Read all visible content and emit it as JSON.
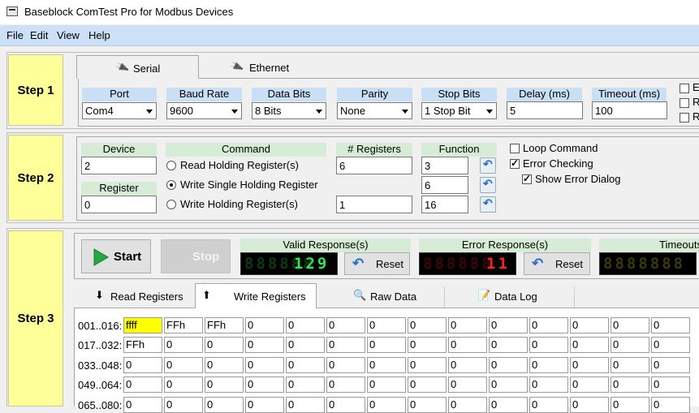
{
  "window": {
    "title": "Baseblock ComTest Pro for Modbus Devices"
  },
  "menu": [
    "File",
    "Edit",
    "View",
    "Help"
  ],
  "step1": {
    "label": "Step 1",
    "tabs": [
      "Serial",
      "Ethernet"
    ],
    "port": {
      "header": "Port",
      "value": "Com4"
    },
    "baud": {
      "header": "Baud Rate",
      "value": "9600"
    },
    "databits": {
      "header": "Data Bits",
      "value": "8 Bits"
    },
    "parity": {
      "header": "Parity",
      "value": "None"
    },
    "stopbits": {
      "header": "Stop Bits",
      "value": "1 Stop Bit"
    },
    "delay": {
      "header": "Delay (ms)",
      "value": "5"
    },
    "timeout": {
      "header": "Timeout (ms)",
      "value": "100"
    },
    "side": [
      "E",
      "R",
      "R"
    ]
  },
  "step2": {
    "label": "Step 2",
    "device": {
      "header": "Device",
      "value": "2"
    },
    "register": {
      "header": "Register",
      "value": "0"
    },
    "command_header": "Command",
    "commands": [
      "Read Holding Register(s)",
      "Write Single Holding Register",
      "Write Holding Register(s)"
    ],
    "selected_command": 1,
    "registers_header": "# Registers",
    "registers_values": [
      "6",
      "1"
    ],
    "function_header": "Function",
    "function_values": [
      "3",
      "6",
      "16"
    ],
    "loop_command": "Loop Command",
    "error_checking": "Error Checking",
    "show_error_dialog": "Show Error Dialog"
  },
  "step3": {
    "label": "Step 3",
    "start": "Start",
    "stop": "Stop",
    "valid": {
      "header": "Valid Response(s)",
      "lcd_dim": "888888",
      "lcd_lit": "129",
      "reset": "Reset"
    },
    "error": {
      "header": "Error Response(s)",
      "lcd_dim": "888888",
      "lcd_lit": "11",
      "reset": "Reset"
    },
    "timeout": {
      "header": "Timeouts",
      "lcd": "8888888"
    },
    "tabs": [
      "Read Registers",
      "Write Registers",
      "Raw Data",
      "Data Log"
    ],
    "rows": [
      {
        "label": "001..016:",
        "cells": [
          "ffff",
          "FFh",
          "FFh",
          "0",
          "0",
          "0",
          "0",
          "0",
          "0",
          "0",
          "0",
          "0",
          "0",
          "0"
        ]
      },
      {
        "label": "017..032:",
        "cells": [
          "FFh",
          "0",
          "0",
          "0",
          "0",
          "0",
          "0",
          "0",
          "0",
          "0",
          "0",
          "0",
          "0",
          "0"
        ]
      },
      {
        "label": "033..048:",
        "cells": [
          "0",
          "0",
          "0",
          "0",
          "0",
          "0",
          "0",
          "0",
          "0",
          "0",
          "0",
          "0",
          "0",
          "0"
        ]
      },
      {
        "label": "049..064:",
        "cells": [
          "0",
          "0",
          "0",
          "0",
          "0",
          "0",
          "0",
          "0",
          "0",
          "0",
          "0",
          "0",
          "0",
          "0"
        ]
      },
      {
        "label": "065..080:",
        "cells": [
          "0",
          "0",
          "0",
          "0",
          "0",
          "0",
          "0",
          "0",
          "0",
          "0",
          "0",
          "0",
          "0",
          "0"
        ]
      }
    ]
  }
}
